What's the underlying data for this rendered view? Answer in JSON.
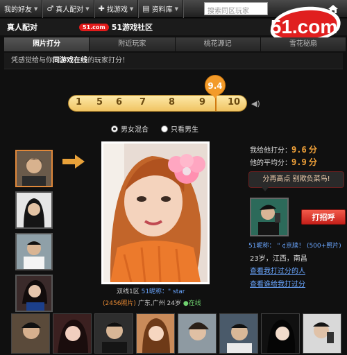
{
  "topnav": {
    "items": [
      {
        "label": "我的好友",
        "icon": "caret-down-icon"
      },
      {
        "label": "真人配对",
        "icon": "people-icon"
      },
      {
        "label": "找游戏",
        "icon": "gamepad-icon"
      },
      {
        "label": "资料库",
        "icon": "book-icon"
      }
    ],
    "search_placeholder": "搜索同区玩家"
  },
  "logo": {
    "brand": "51.com"
  },
  "subbar": {
    "title": "真人配对",
    "community_pill": "51.com",
    "community_text": "51游戏社区"
  },
  "tabs": [
    {
      "label": "照片打分",
      "active": true
    },
    {
      "label": "附近玩家",
      "active": false
    },
    {
      "label": "桃花源记",
      "active": false
    },
    {
      "label": "雪花秘扇",
      "active": false
    }
  ],
  "intro": {
    "prefix": "凭感觉给与你",
    "bold": "同游戏在线",
    "suffix": "的玩家打分！"
  },
  "rating": {
    "numbers": [
      "1",
      "5",
      "6",
      "7",
      "8",
      "9",
      "10"
    ],
    "current": "9.4"
  },
  "gender": {
    "options": [
      "男女混合",
      "只看男生"
    ],
    "selected": 0
  },
  "photo": {
    "line1_prefix": "双线1区 ",
    "line1_name": "51昵称：\" star",
    "line2_count": "(2456照片)",
    "line2_loc": "广东,广州 24岁",
    "line2_status": "在线"
  },
  "scores": {
    "my_label": "我给他打分：",
    "my_value": "9.6",
    "avg_label": "他的平均分：",
    "avg_value": "9.9",
    "unit": "分"
  },
  "tip": "分再高点 别欺负菜鸟!",
  "friend": {
    "greet_button": "打招呼",
    "nickname_label": "51昵称：",
    "nickname": "\" ¢京牍！",
    "photo_count": "(500+照片)",
    "location": "23岁，江西，南昌"
  },
  "links": [
    "查看我打过分的人",
    "查看谁给我打过分"
  ],
  "colors": {
    "accent": "#f39b2a",
    "link": "#6aa6ff",
    "brand_red": "#e21a1a"
  }
}
